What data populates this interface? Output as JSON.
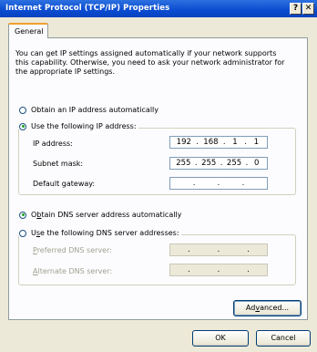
{
  "window": {
    "title": "Internet Protocol (TCP/IP) Properties",
    "help_button": "?",
    "close_button": "✕"
  },
  "tabs": [
    {
      "label": "General",
      "selected": true
    }
  ],
  "description": {
    "line1": "You can get IP settings assigned automatically if your network supports",
    "line2": "this capability. Otherwise, you need to ask your network administrator for",
    "line3": "the appropriate IP settings."
  },
  "ip_mode": {
    "auto_label": "Obtain an IP address automatically",
    "manual_label": "Use the following IP address:",
    "selected": "manual"
  },
  "ip_fields": {
    "ip_address": {
      "label": "IP address:",
      "octets": [
        "192",
        "168",
        "1",
        "1"
      ]
    },
    "subnet_mask": {
      "label": "Subnet mask:",
      "octets": [
        "255",
        "255",
        "255",
        "0"
      ]
    },
    "default_gateway": {
      "label": "Default gateway:",
      "octets": [
        "",
        "",
        "",
        ""
      ]
    }
  },
  "dns_mode": {
    "auto_prefix": "O",
    "auto_underlined": "b",
    "auto_rest": "tain DNS server address automatically",
    "manual_prefix": "U",
    "manual_underlined": "s",
    "manual_rest": "e the following DNS server addresses:",
    "selected": "auto"
  },
  "dns_fields": {
    "preferred": {
      "underlined": "P",
      "rest": "referred DNS server:",
      "enabled": false
    },
    "alternate": {
      "underlined": "A",
      "rest": "lternate DNS server:",
      "enabled": false
    }
  },
  "buttons": {
    "advanced_prefix": "Ad",
    "advanced_underlined": "v",
    "advanced_rest": "anced...",
    "ok": "OK",
    "cancel": "Cancel"
  },
  "colors": {
    "title_bar": "#0a4bd0",
    "dialog_bg": "#ece9d8",
    "selected_radio_dot": "#21a121"
  }
}
